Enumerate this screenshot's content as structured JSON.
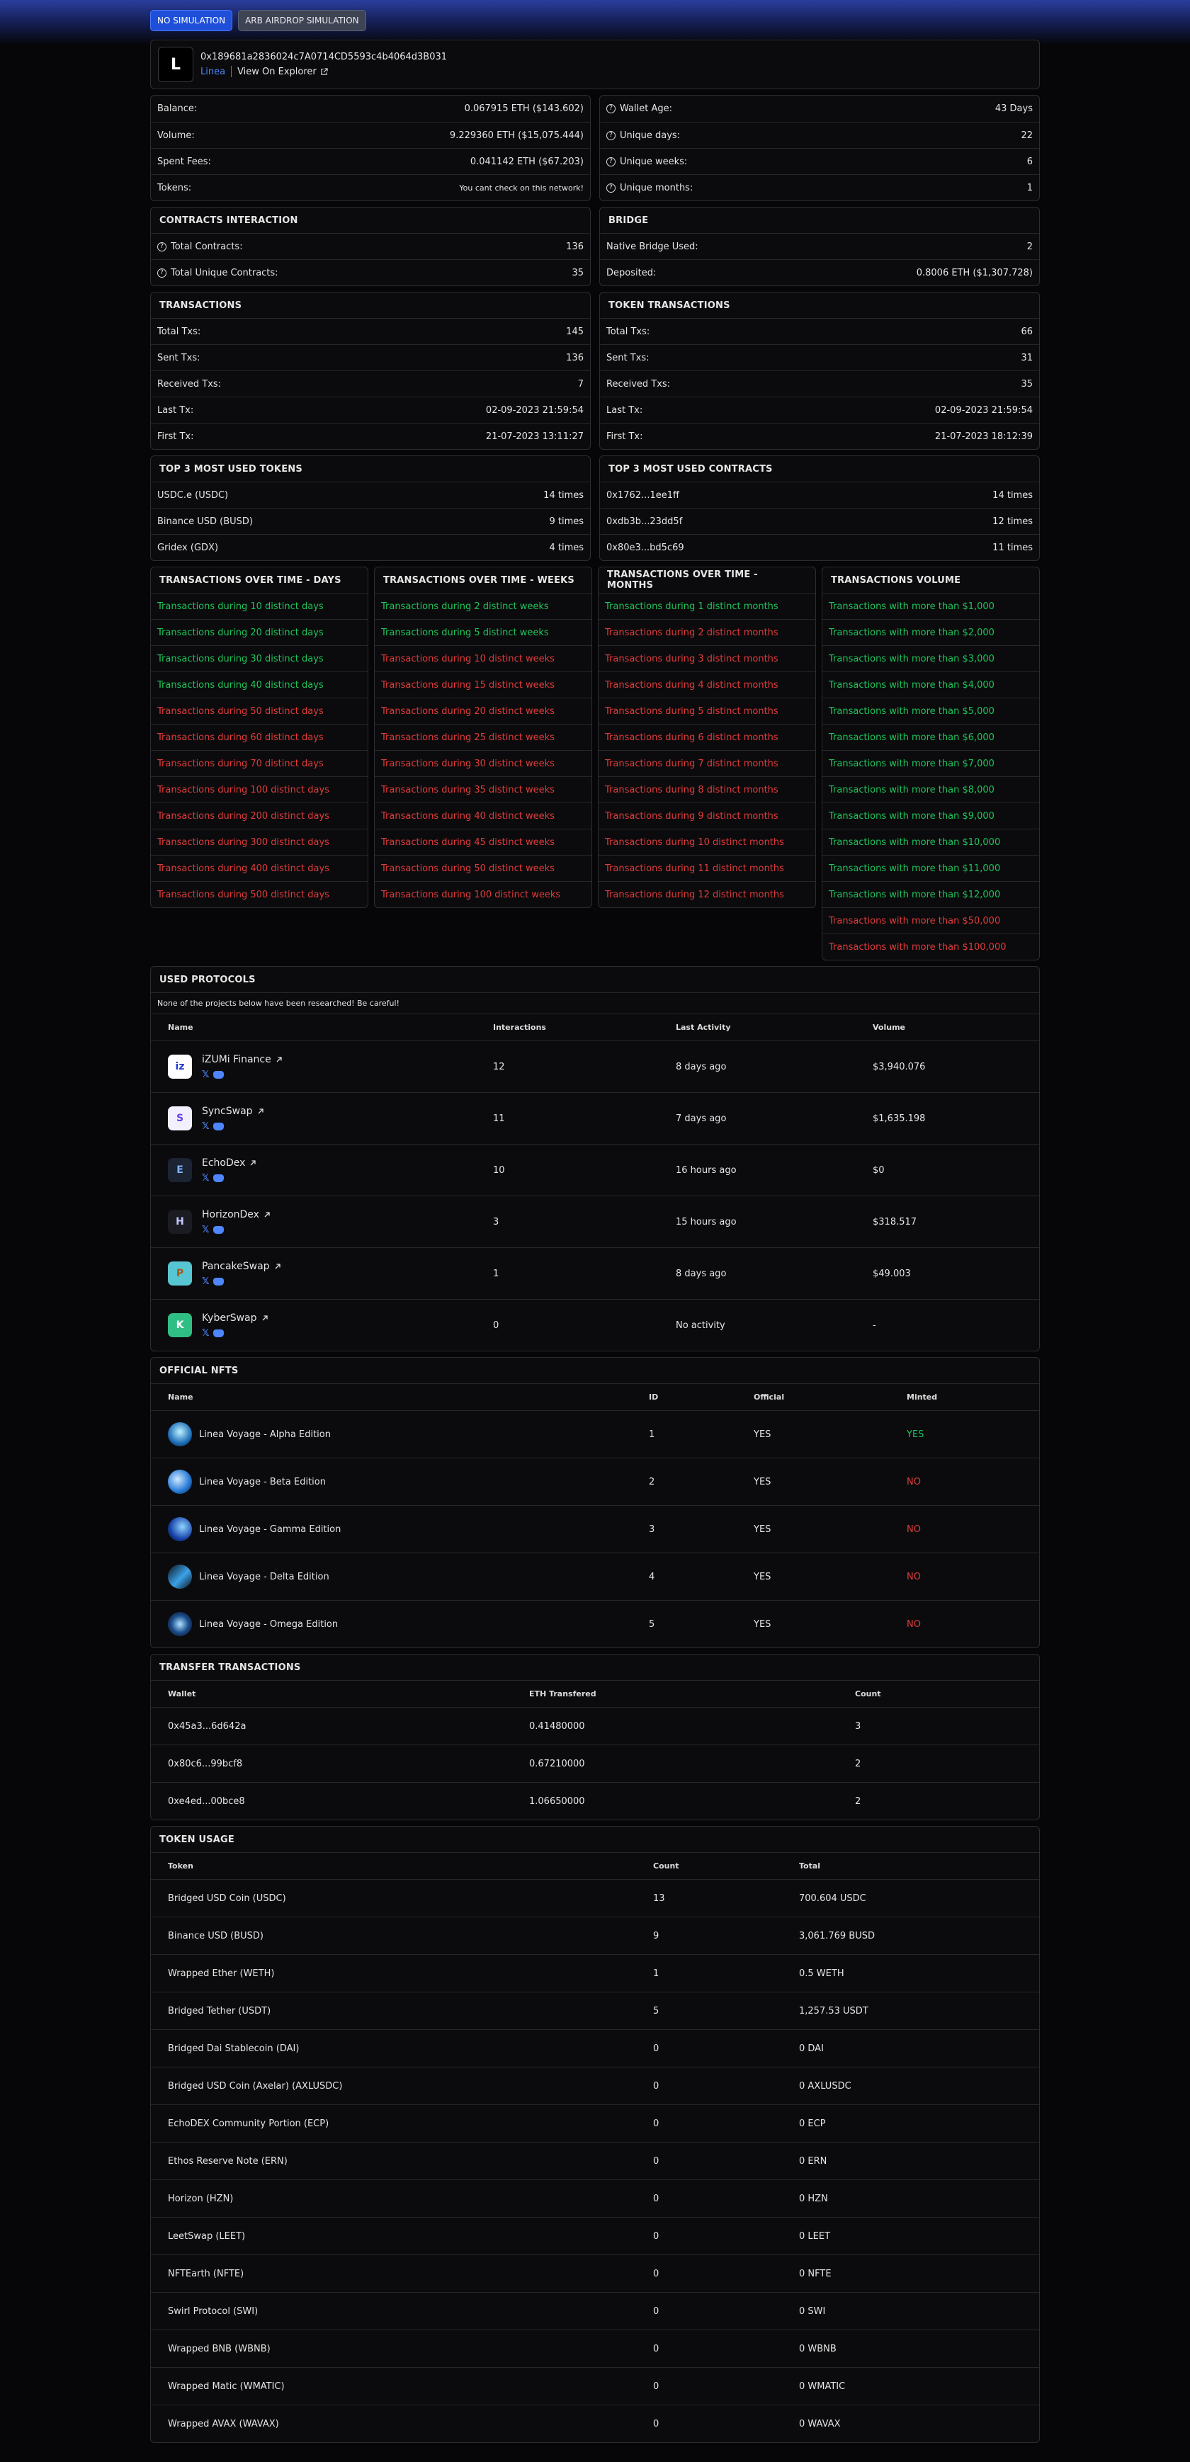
{
  "sim": {
    "no": "NO SIMULATION",
    "arb": "ARB AIRDROP SIMULATION"
  },
  "wallet": {
    "logo": "L",
    "address": "0x189681a2836024c7A0714CD5593c4b4064d3B031",
    "network": "Linea",
    "explorer": "View On Explorer"
  },
  "stats_left": [
    {
      "label": "Balance:",
      "value": "0.067915 ETH ($143.602)"
    },
    {
      "label": "Volume:",
      "value": "9.229360 ETH ($15,075.444)"
    },
    {
      "label": "Spent Fees:",
      "value": "0.041142 ETH ($67.203)"
    },
    {
      "label": "Tokens:",
      "value": "You cant check on this network!"
    }
  ],
  "stats_right": [
    {
      "label": "Wallet Age:",
      "value": "43 Days"
    },
    {
      "label": "Unique days:",
      "value": "22"
    },
    {
      "label": "Unique weeks:",
      "value": "6"
    },
    {
      "label": "Unique months:",
      "value": "1"
    }
  ],
  "contracts": {
    "title": "CONTRACTS INTERACTION",
    "rows": [
      {
        "label": "Total Contracts:",
        "value": "136"
      },
      {
        "label": "Total Unique Contracts:",
        "value": "35"
      }
    ]
  },
  "bridge": {
    "title": "BRIDGE",
    "rows": [
      {
        "label": "Native Bridge Used:",
        "value": "2"
      },
      {
        "label": "Deposited:",
        "value": "0.8006 ETH ($1,307.728)"
      }
    ]
  },
  "transactions": {
    "title": "TRANSACTIONS",
    "rows": [
      {
        "label": "Total Txs:",
        "value": "145"
      },
      {
        "label": "Sent Txs:",
        "value": "136"
      },
      {
        "label": "Received Txs:",
        "value": "7"
      },
      {
        "label": "Last Tx:",
        "value": "02-09-2023 21:59:54"
      },
      {
        "label": "First Tx:",
        "value": "21-07-2023 13:11:27"
      }
    ]
  },
  "token_transactions": {
    "title": "TOKEN TRANSACTIONS",
    "rows": [
      {
        "label": "Total Txs:",
        "value": "66"
      },
      {
        "label": "Sent Txs:",
        "value": "31"
      },
      {
        "label": "Received Txs:",
        "value": "35"
      },
      {
        "label": "Last Tx:",
        "value": "02-09-2023 21:59:54"
      },
      {
        "label": "First Tx:",
        "value": "21-07-2023 18:12:39"
      }
    ]
  },
  "top_tokens": {
    "title": "TOP 3 MOST USED TOKENS",
    "rows": [
      {
        "label": "USDC.e (USDC)",
        "value": "14 times"
      },
      {
        "label": "Binance USD (BUSD)",
        "value": "9 times"
      },
      {
        "label": "Gridex (GDX)",
        "value": "4 times"
      }
    ]
  },
  "top_contracts": {
    "title": "TOP 3 MOST USED CONTRACTS",
    "rows": [
      {
        "label": "0x1762...1ee1ff",
        "value": "14 times"
      },
      {
        "label": "0xdb3b...23dd5f",
        "value": "12 times"
      },
      {
        "label": "0x80e3...bd5c69",
        "value": "11 times"
      }
    ]
  },
  "over_days": {
    "title": "TRANSACTIONS OVER TIME - DAYS",
    "items": [
      {
        "text": "Transactions during 10 distinct days",
        "ok": true
      },
      {
        "text": "Transactions during 20 distinct days",
        "ok": true
      },
      {
        "text": "Transactions during 30 distinct days",
        "ok": true
      },
      {
        "text": "Transactions during 40 distinct days",
        "ok": true
      },
      {
        "text": "Transactions during 50 distinct days",
        "ok": false
      },
      {
        "text": "Transactions during 60 distinct days",
        "ok": false
      },
      {
        "text": "Transactions during 70 distinct days",
        "ok": false
      },
      {
        "text": "Transactions during 100 distinct days",
        "ok": false
      },
      {
        "text": "Transactions during 200 distinct days",
        "ok": false
      },
      {
        "text": "Transactions during 300 distinct days",
        "ok": false
      },
      {
        "text": "Transactions during 400 distinct days",
        "ok": false
      },
      {
        "text": "Transactions during 500 distinct days",
        "ok": false
      }
    ]
  },
  "over_weeks": {
    "title": "TRANSACTIONS OVER TIME - WEEKS",
    "items": [
      {
        "text": "Transactions during 2 distinct weeks",
        "ok": true
      },
      {
        "text": "Transactions during 5 distinct weeks",
        "ok": true
      },
      {
        "text": "Transactions during 10 distinct weeks",
        "ok": false
      },
      {
        "text": "Transactions during 15 distinct weeks",
        "ok": false
      },
      {
        "text": "Transactions during 20 distinct weeks",
        "ok": false
      },
      {
        "text": "Transactions during 25 distinct weeks",
        "ok": false
      },
      {
        "text": "Transactions during 30 distinct weeks",
        "ok": false
      },
      {
        "text": "Transactions during 35 distinct weeks",
        "ok": false
      },
      {
        "text": "Transactions during 40 distinct weeks",
        "ok": false
      },
      {
        "text": "Transactions during 45 distinct weeks",
        "ok": false
      },
      {
        "text": "Transactions during 50 distinct weeks",
        "ok": false
      },
      {
        "text": "Transactions during 100 distinct weeks",
        "ok": false
      }
    ]
  },
  "over_months": {
    "title": "TRANSACTIONS OVER TIME - MONTHS",
    "items": [
      {
        "text": "Transactions during 1 distinct months",
        "ok": true
      },
      {
        "text": "Transactions during 2 distinct months",
        "ok": false
      },
      {
        "text": "Transactions during 3 distinct months",
        "ok": false
      },
      {
        "text": "Transactions during 4 distinct months",
        "ok": false
      },
      {
        "text": "Transactions during 5 distinct months",
        "ok": false
      },
      {
        "text": "Transactions during 6 distinct months",
        "ok": false
      },
      {
        "text": "Transactions during 7 distinct months",
        "ok": false
      },
      {
        "text": "Transactions during 8 distinct months",
        "ok": false
      },
      {
        "text": "Transactions during 9 distinct months",
        "ok": false
      },
      {
        "text": "Transactions during 10 distinct months",
        "ok": false
      },
      {
        "text": "Transactions during 11 distinct months",
        "ok": false
      },
      {
        "text": "Transactions during 12 distinct months",
        "ok": false
      }
    ]
  },
  "volume": {
    "title": "TRANSACTIONS VOLUME",
    "items": [
      {
        "text": "Transactions with more than $1,000",
        "ok": true
      },
      {
        "text": "Transactions with more than $2,000",
        "ok": true
      },
      {
        "text": "Transactions with more than $3,000",
        "ok": true
      },
      {
        "text": "Transactions with more than $4,000",
        "ok": true
      },
      {
        "text": "Transactions with more than $5,000",
        "ok": true
      },
      {
        "text": "Transactions with more than $6,000",
        "ok": true
      },
      {
        "text": "Transactions with more than $7,000",
        "ok": true
      },
      {
        "text": "Transactions with more than $8,000",
        "ok": true
      },
      {
        "text": "Transactions with more than $9,000",
        "ok": true
      },
      {
        "text": "Transactions with more than $10,000",
        "ok": true
      },
      {
        "text": "Transactions with more than $11,000",
        "ok": true
      },
      {
        "text": "Transactions with more than $12,000",
        "ok": true
      },
      {
        "text": "Transactions with more than $50,000",
        "ok": false
      },
      {
        "text": "Transactions with more than $100,000",
        "ok": false
      }
    ]
  },
  "protocols": {
    "title": "USED PROTOCOLS",
    "warning": "None of the projects below have been researched! Be careful!",
    "columns": [
      "Name",
      "Interactions",
      "Last Activity",
      "Volume"
    ],
    "rows": [
      {
        "name": "iZUMi Finance",
        "interactions": "12",
        "last": "8 days ago",
        "volume": "$3,940.076",
        "logo": "iz",
        "bg": "#ffffff",
        "fg": "#1e3ad8"
      },
      {
        "name": "SyncSwap",
        "interactions": "11",
        "last": "7 days ago",
        "volume": "$1,635.198",
        "logo": "S",
        "bg": "#f2f0ff",
        "fg": "#6a3ef0"
      },
      {
        "name": "EchoDex",
        "interactions": "10",
        "last": "16 hours ago",
        "volume": "$0",
        "logo": "E",
        "bg": "#1c2333",
        "fg": "#7fb2ff"
      },
      {
        "name": "HorizonDex",
        "interactions": "3",
        "last": "15 hours ago",
        "volume": "$318.517",
        "logo": "H",
        "bg": "#1b1b22",
        "fg": "#c6c8ff"
      },
      {
        "name": "PancakeSwap",
        "interactions": "1",
        "last": "8 days ago",
        "volume": "$49.003",
        "logo": "P",
        "bg": "#58c5d3",
        "fg": "#a3581c"
      },
      {
        "name": "KyberSwap",
        "interactions": "0",
        "last": "No activity",
        "volume": "-",
        "logo": "K",
        "bg": "#2fbf84",
        "fg": "#ffffff"
      }
    ]
  },
  "nfts": {
    "title": "OFFICIAL NFTS",
    "columns": [
      "Name",
      "ID",
      "Official",
      "Minted"
    ],
    "rows": [
      {
        "name": "Linea Voyage - Alpha Edition",
        "id": "1",
        "official": "YES",
        "minted": "YES",
        "ok": true
      },
      {
        "name": "Linea Voyage - Beta Edition",
        "id": "2",
        "official": "YES",
        "minted": "NO",
        "ok": false
      },
      {
        "name": "Linea Voyage - Gamma Edition",
        "id": "3",
        "official": "YES",
        "minted": "NO",
        "ok": false
      },
      {
        "name": "Linea Voyage - Delta Edition",
        "id": "4",
        "official": "YES",
        "minted": "NO",
        "ok": false
      },
      {
        "name": "Linea Voyage - Omega Edition",
        "id": "5",
        "official": "YES",
        "minted": "NO",
        "ok": false
      }
    ]
  },
  "transfers": {
    "title": "TRANSFER TRANSACTIONS",
    "columns": [
      "Wallet",
      "ETH Transfered",
      "Count"
    ],
    "rows": [
      {
        "wallet": "0x45a3...6d642a",
        "eth": "0.41480000",
        "count": "3"
      },
      {
        "wallet": "0x80c6...99bcf8",
        "eth": "0.67210000",
        "count": "2"
      },
      {
        "wallet": "0xe4ed...00bce8",
        "eth": "1.06650000",
        "count": "2"
      }
    ]
  },
  "token_usage": {
    "title": "TOKEN USAGE",
    "columns": [
      "Token",
      "Count",
      "Total"
    ],
    "rows": [
      {
        "token": "Bridged USD Coin (USDC)",
        "count": "13",
        "total": "700.604 USDC"
      },
      {
        "token": "Binance USD (BUSD)",
        "count": "9",
        "total": "3,061.769 BUSD"
      },
      {
        "token": "Wrapped Ether (WETH)",
        "count": "1",
        "total": "0.5 WETH"
      },
      {
        "token": "Bridged Tether (USDT)",
        "count": "5",
        "total": "1,257.53 USDT"
      },
      {
        "token": "Bridged Dai Stablecoin (DAI)",
        "count": "0",
        "total": "0 DAI"
      },
      {
        "token": "Bridged USD Coin (Axelar) (AXLUSDC)",
        "count": "0",
        "total": "0 AXLUSDC"
      },
      {
        "token": "EchoDEX Community Portion (ECP)",
        "count": "0",
        "total": "0 ECP"
      },
      {
        "token": "Ethos Reserve Note (ERN)",
        "count": "0",
        "total": "0 ERN"
      },
      {
        "token": "Horizon (HZN)",
        "count": "0",
        "total": "0 HZN"
      },
      {
        "token": "LeetSwap (LEET)",
        "count": "0",
        "total": "0 LEET"
      },
      {
        "token": "NFTEarth (NFTE)",
        "count": "0",
        "total": "0 NFTE"
      },
      {
        "token": "Swirl Protocol (SWI)",
        "count": "0",
        "total": "0 SWI"
      },
      {
        "token": "Wrapped BNB (WBNB)",
        "count": "0",
        "total": "0 WBNB"
      },
      {
        "token": "Wrapped Matic (WMATIC)",
        "count": "0",
        "total": "0 WMATIC"
      },
      {
        "token": "Wrapped AVAX (WAVAX)",
        "count": "0",
        "total": "0 WAVAX"
      }
    ]
  }
}
